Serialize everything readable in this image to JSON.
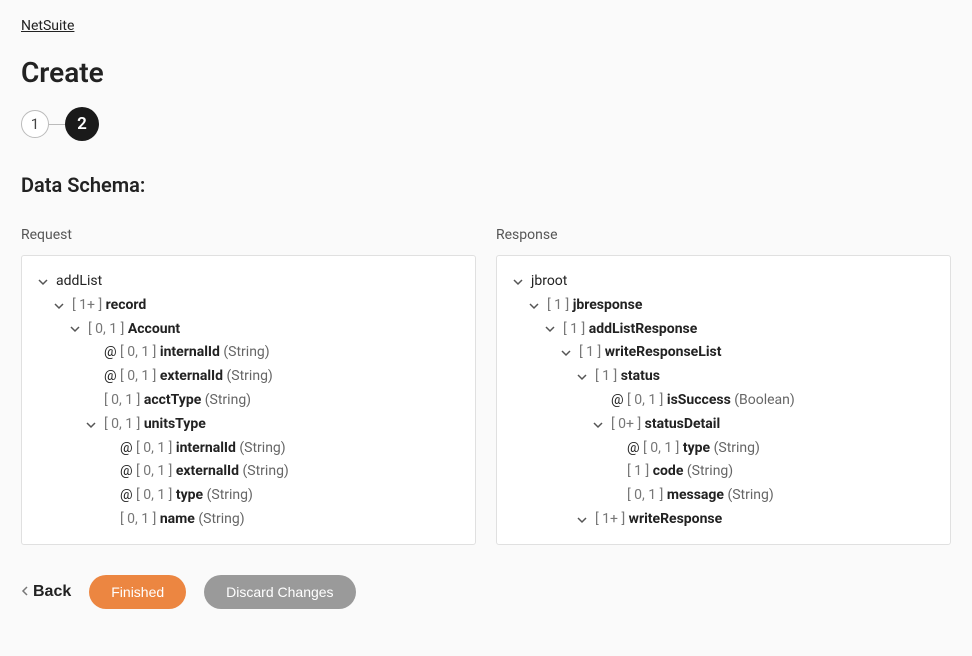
{
  "breadcrumb": {
    "label": "NetSuite"
  },
  "title": "Create",
  "stepper": {
    "steps": [
      "1",
      "2"
    ],
    "active_index": 1
  },
  "section_heading": "Data Schema:",
  "request": {
    "label": "Request",
    "tree": [
      {
        "indent": 0,
        "chevron": true,
        "prefix": "",
        "card": "",
        "name": "addList",
        "name_bold": false,
        "type": ""
      },
      {
        "indent": 1,
        "chevron": true,
        "prefix": "",
        "card": "[ 1+ ]",
        "name": "record",
        "name_bold": true,
        "type": ""
      },
      {
        "indent": 2,
        "chevron": true,
        "prefix": "",
        "card": "[ 0, 1 ]",
        "name": "Account",
        "name_bold": true,
        "type": ""
      },
      {
        "indent": 3,
        "chevron": false,
        "prefix": "@",
        "card": "[ 0, 1 ]",
        "name": "internalId",
        "name_bold": true,
        "type": "(String)"
      },
      {
        "indent": 3,
        "chevron": false,
        "prefix": "@",
        "card": "[ 0, 1 ]",
        "name": "externalId",
        "name_bold": true,
        "type": "(String)"
      },
      {
        "indent": 3,
        "chevron": false,
        "prefix": "",
        "card": "[ 0, 1 ]",
        "name": "acctType",
        "name_bold": true,
        "type": "(String)"
      },
      {
        "indent": 3,
        "chevron": true,
        "prefix": "",
        "card": "[ 0, 1 ]",
        "name": "unitsType",
        "name_bold": true,
        "type": ""
      },
      {
        "indent": 4,
        "chevron": false,
        "prefix": "@",
        "card": "[ 0, 1 ]",
        "name": "internalId",
        "name_bold": true,
        "type": "(String)"
      },
      {
        "indent": 4,
        "chevron": false,
        "prefix": "@",
        "card": "[ 0, 1 ]",
        "name": "externalId",
        "name_bold": true,
        "type": "(String)"
      },
      {
        "indent": 4,
        "chevron": false,
        "prefix": "@",
        "card": "[ 0, 1 ]",
        "name": "type",
        "name_bold": true,
        "type": "(String)"
      },
      {
        "indent": 4,
        "chevron": false,
        "prefix": "",
        "card": "[ 0, 1 ]",
        "name": "name",
        "name_bold": true,
        "type": "(String)"
      }
    ]
  },
  "response": {
    "label": "Response",
    "tree": [
      {
        "indent": 0,
        "chevron": true,
        "prefix": "",
        "card": "",
        "name": "jbroot",
        "name_bold": false,
        "type": ""
      },
      {
        "indent": 1,
        "chevron": true,
        "prefix": "",
        "card": "[ 1 ]",
        "name": "jbresponse",
        "name_bold": true,
        "type": ""
      },
      {
        "indent": 2,
        "chevron": true,
        "prefix": "",
        "card": "[ 1 ]",
        "name": "addListResponse",
        "name_bold": true,
        "type": ""
      },
      {
        "indent": 3,
        "chevron": true,
        "prefix": "",
        "card": "[ 1 ]",
        "name": "writeResponseList",
        "name_bold": true,
        "type": ""
      },
      {
        "indent": 4,
        "chevron": true,
        "prefix": "",
        "card": "[ 1 ]",
        "name": "status",
        "name_bold": true,
        "type": ""
      },
      {
        "indent": 5,
        "chevron": false,
        "prefix": "@",
        "card": "[ 0, 1 ]",
        "name": "isSuccess",
        "name_bold": true,
        "type": "(Boolean)"
      },
      {
        "indent": 5,
        "chevron": true,
        "prefix": "",
        "card": "[ 0+ ]",
        "name": "statusDetail",
        "name_bold": true,
        "type": ""
      },
      {
        "indent": 6,
        "chevron": false,
        "prefix": "@",
        "card": "[ 0, 1 ]",
        "name": "type",
        "name_bold": true,
        "type": "(String)"
      },
      {
        "indent": 6,
        "chevron": false,
        "prefix": "",
        "card": "[ 1 ]",
        "name": "code",
        "name_bold": true,
        "type": "(String)"
      },
      {
        "indent": 6,
        "chevron": false,
        "prefix": "",
        "card": "[ 0, 1 ]",
        "name": "message",
        "name_bold": true,
        "type": "(String)"
      },
      {
        "indent": 4,
        "chevron": true,
        "prefix": "",
        "card": "[ 1+ ]",
        "name": "writeResponse",
        "name_bold": true,
        "type": ""
      }
    ]
  },
  "footer": {
    "back": "Back",
    "finished": "Finished",
    "discard": "Discard Changes"
  }
}
